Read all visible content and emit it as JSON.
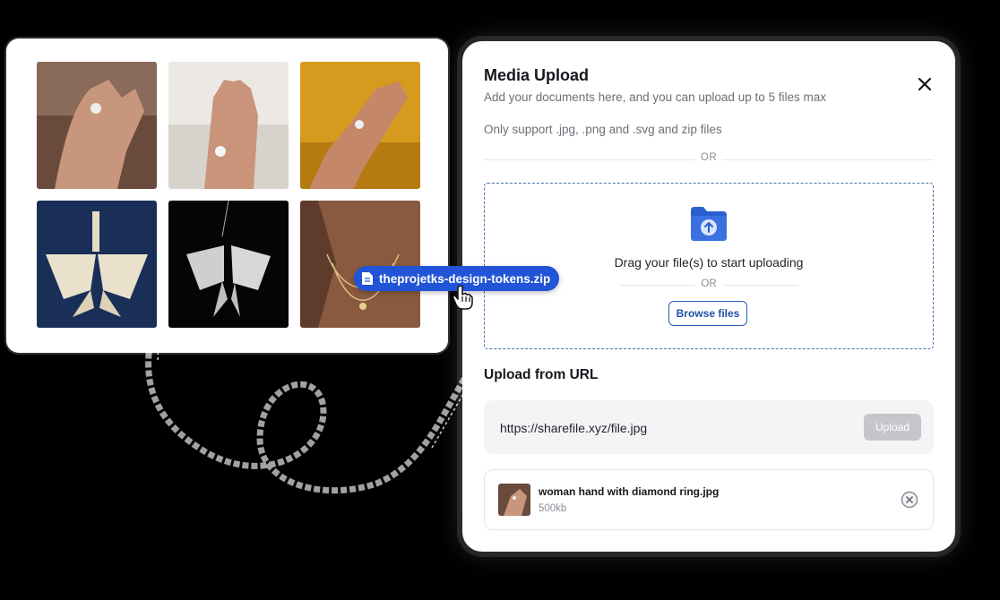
{
  "gallery": {
    "images": [
      {
        "name": "ring-hand-1"
      },
      {
        "name": "ring-hand-2"
      },
      {
        "name": "ring-hand-3"
      },
      {
        "name": "butterfly-pendant-gold"
      },
      {
        "name": "butterfly-pendant-silver"
      },
      {
        "name": "necklace-neck"
      }
    ]
  },
  "drag_chip": {
    "label": "theprojetks-design-tokens.zip",
    "icon": "file-icon"
  },
  "modal": {
    "title": "Media Upload",
    "subtitle": "Add your documents here, and you can upload up to 5 files max",
    "support_text": "Only support .jpg, .png and .svg and zip files",
    "or_label": "OR",
    "dropzone": {
      "icon": "folder-upload-icon",
      "text": "Drag your file(s) to start uploading",
      "or_label": "OR",
      "browse_label": "Browse files"
    },
    "url_section": {
      "title": "Upload from URL",
      "value": "https://sharefile.xyz/file.jpg",
      "upload_label": "Upload"
    },
    "files": [
      {
        "name": "woman hand with diamond ring.jpg",
        "size": "500kb"
      }
    ]
  },
  "colors": {
    "accent": "#2154d6",
    "dropzone_border": "#4a6fb0",
    "disabled": "#c4c6ca"
  }
}
